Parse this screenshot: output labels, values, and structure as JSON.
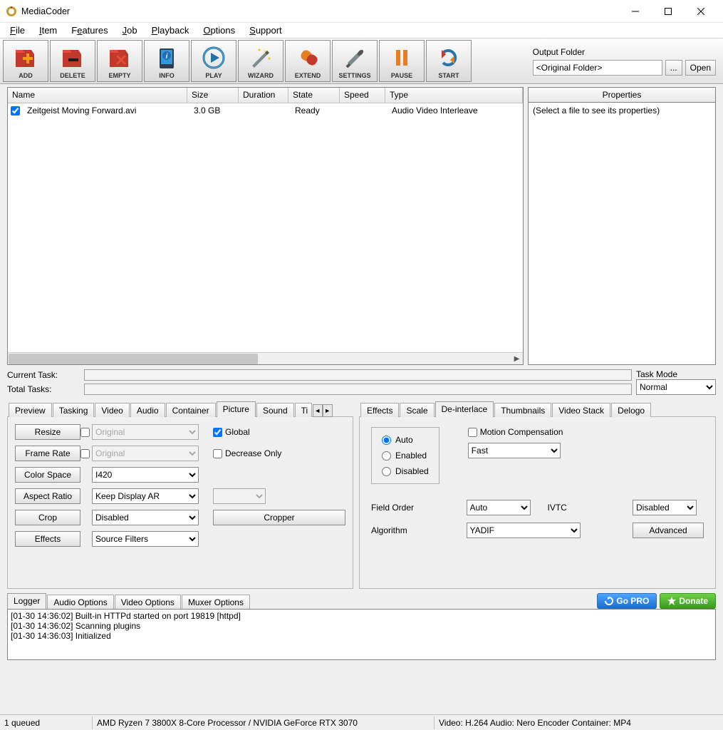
{
  "app_title": "MediaCoder",
  "menu": [
    "File",
    "Item",
    "Features",
    "Job",
    "Playback",
    "Options",
    "Support"
  ],
  "toolbar": {
    "add": "ADD",
    "delete": "DELETE",
    "empty": "EMPTY",
    "info": "INFO",
    "play": "PLAY",
    "wizard": "WIZARD",
    "extend": "EXTEND",
    "settings": "SETTINGS",
    "pause": "PAUSE",
    "start": "START"
  },
  "output_folder_label": "Output Folder",
  "output_folder_value": "<Original Folder>",
  "btn_browse": "...",
  "btn_open": "Open",
  "columns": {
    "name": "Name",
    "size": "Size",
    "duration": "Duration",
    "state": "State",
    "speed": "Speed",
    "type": "Type"
  },
  "files": [
    {
      "name": "Zeitgeist Moving Forward.avi",
      "size": "3.0 GB",
      "duration": "",
      "state": "Ready",
      "speed": "",
      "type": "Audio Video Interleave"
    }
  ],
  "properties_header": "Properties",
  "properties_placeholder": "(Select a file to see its properties)",
  "current_task_label": "Current Task:",
  "total_tasks_label": "Total Tasks:",
  "task_mode_label": "Task Mode",
  "task_mode_value": "Normal",
  "tabs_left": [
    "Preview",
    "Tasking",
    "Video",
    "Audio",
    "Container",
    "Picture",
    "Sound",
    "Ti"
  ],
  "tabs_left_active": "Picture",
  "tabs_right": [
    "Effects",
    "Scale",
    "De-interlace",
    "Thumbnails",
    "Video Stack",
    "Delogo"
  ],
  "tabs_right_active": "De-interlace",
  "picture": {
    "resize": "Resize",
    "frame_rate": "Frame Rate",
    "color_space": "Color Space",
    "aspect_ratio": "Aspect Ratio",
    "crop": "Crop",
    "effects": "Effects",
    "resize_val": "Original",
    "frame_rate_val": "Original",
    "color_space_val": "I420",
    "aspect_ratio_val": "Keep Display AR",
    "crop_val": "Disabled",
    "effects_val": "Source Filters",
    "global": "Global",
    "decrease_only": "Decrease Only",
    "cropper": "Cropper"
  },
  "deinterlace": {
    "auto": "Auto",
    "enabled": "Enabled",
    "disabled": "Disabled",
    "motion_comp": "Motion Compensation",
    "motion_val": "Fast",
    "field_order_lbl": "Field Order",
    "field_order_val": "Auto",
    "ivtc_lbl": "IVTC",
    "ivtc_val": "Disabled",
    "algorithm_lbl": "Algorithm",
    "algorithm_val": "YADIF",
    "advanced": "Advanced"
  },
  "lower_tabs": [
    "Logger",
    "Audio Options",
    "Video Options",
    "Muxer Options"
  ],
  "lower_active": "Logger",
  "go_pro": "Go PRO",
  "donate": "Donate",
  "log": [
    "[01-30 14:36:02] Built-in HTTPd started on port 19819 [httpd]",
    "[01-30 14:36:02] Scanning plugins",
    "[01-30 14:36:03] Initialized"
  ],
  "status": {
    "queued": "1 queued",
    "cpu": "AMD Ryzen 7 3800X 8-Core Processor  / NVIDIA GeForce RTX 3070",
    "enc": "Video: H.264  Audio: Nero Encoder  Container: MP4"
  }
}
